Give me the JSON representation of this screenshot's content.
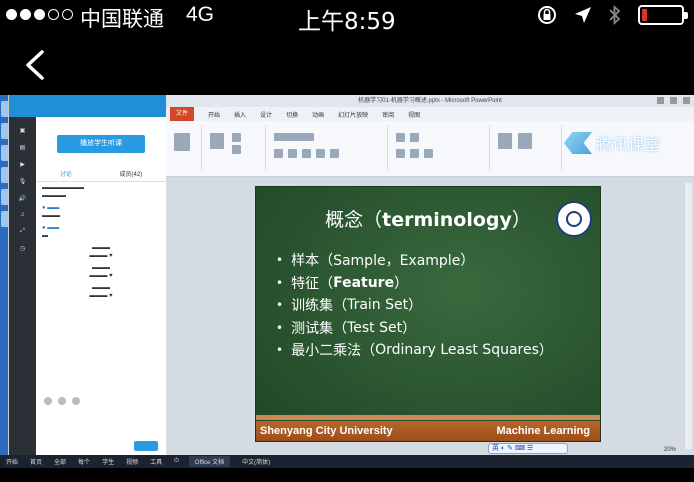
{
  "status_bar": {
    "signal_full": 3,
    "signal_total": 5,
    "carrier": "中国联通",
    "network": "4G",
    "time": "上午8:59",
    "battery_level_fraction": 0.12,
    "battery_color": "#e0302c"
  },
  "nav": {
    "back_icon": "chevron-left-icon"
  },
  "ppt": {
    "window_title": "机器学习01-机器学习概述.pptx - Microsoft PowerPoint",
    "tabs": [
      "文件",
      "开始",
      "插入",
      "设计",
      "切换",
      "动画",
      "幻灯片放映",
      "审阅",
      "视图"
    ],
    "brand_text": "腾讯课堂",
    "ime_text": "英",
    "zoom_text": "20%"
  },
  "slide": {
    "title_cn": "概念（",
    "title_en": "terminology",
    "title_close": "）",
    "bullets": [
      {
        "cn": "样本（",
        "en": "Sample，Example",
        "close": "）",
        "bold": false
      },
      {
        "cn": "特征（",
        "en": "Feature",
        "close": "）",
        "bold": true
      },
      {
        "cn": "训练集（",
        "en": "Train Set",
        "close": "）",
        "bold": false
      },
      {
        "cn": "测试集（",
        "en": "Test Set",
        "close": "）",
        "bold": false
      },
      {
        "cn": "最小二乘法（",
        "en": "Ordinary Least Squares",
        "close": "）",
        "bold": false
      }
    ],
    "footer_left": "Shenyang City University",
    "footer_right": "Machine Learning",
    "background_color": "#2a5530",
    "footer_color": "#b8662a"
  },
  "chat": {
    "enter_button": "播放学生听课",
    "tabs": [
      "讨论",
      "成员(42)"
    ],
    "accent_color": "#2a9be3"
  },
  "taskbar": {
    "items": [
      "开始",
      "首页",
      "全部",
      "每个",
      "学生",
      "视频",
      "工具"
    ],
    "window_label": "Office 文档",
    "window_label_2": "中文(简体)"
  }
}
